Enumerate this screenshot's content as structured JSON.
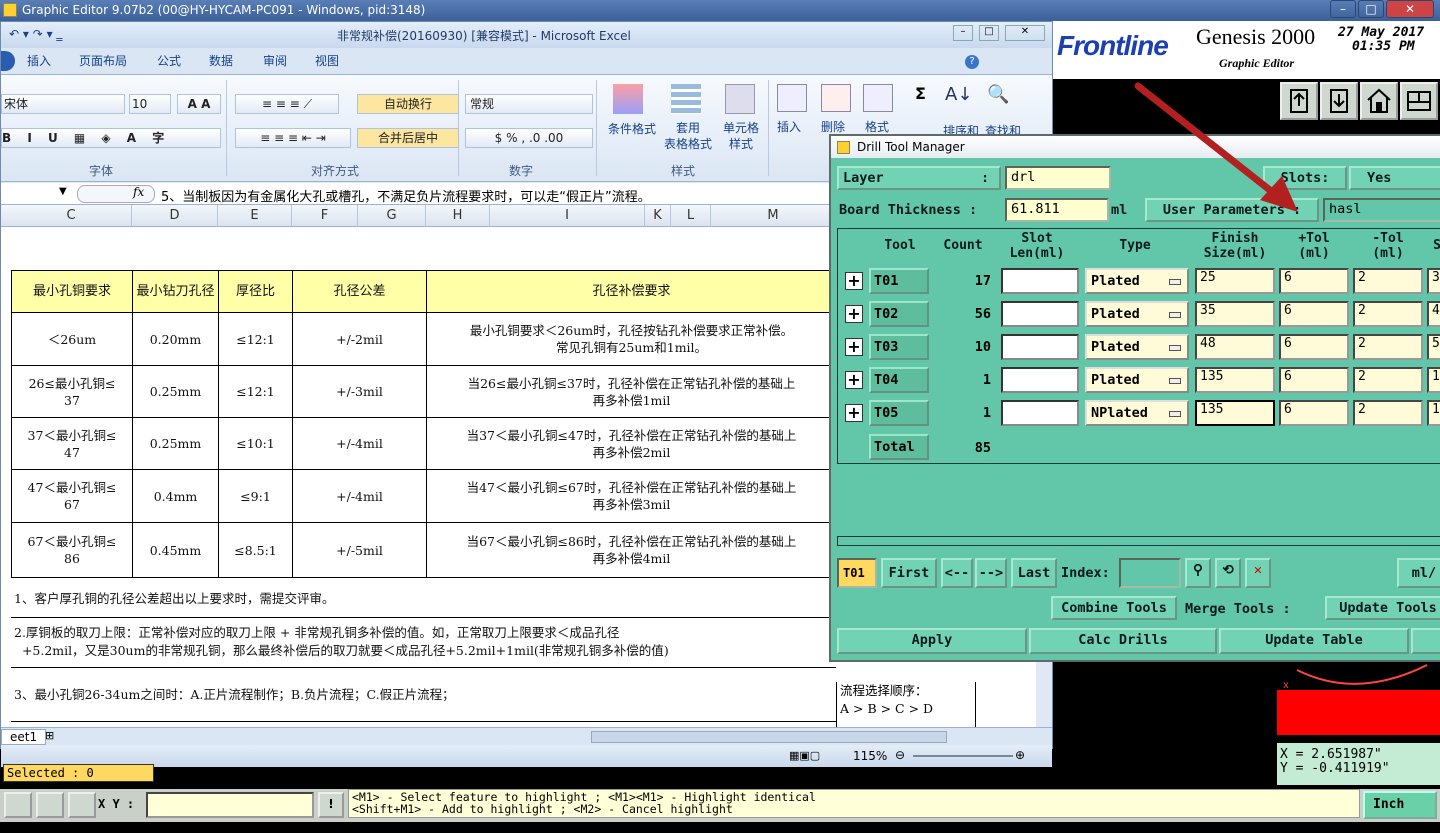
{
  "genesis": {
    "title": "Graphic Editor 9.07b2 (00@HY-HYCAM-PC091 - Windows, pid:3148)",
    "logo": "Frontline",
    "product": "Genesis 2000",
    "subtitle": "Graphic Editor",
    "date": "27 May 2017",
    "time": "01:35 PM",
    "coord_x": "X = 2.651987\"",
    "coord_y": "Y = -0.411919\"",
    "selected": "Selected : 0",
    "xy_label": "X Y :",
    "hint1": "<M1> - Select feature to highlight ; <M1><M1> - Highlight identical",
    "hint2": "<Shift+M1> - Add to highlight ; <M2> - Cancel highlight",
    "units": "Inch",
    "behind_text1": "流程选择顺序：",
    "behind_text2": "A > B > C > D"
  },
  "excel": {
    "title": "非常规补偿(20160930)  [兼容模式] - Microsoft Excel",
    "tabs": [
      "插入",
      "页面布局",
      "公式",
      "数据",
      "审阅",
      "视图"
    ],
    "font_name": "宋体",
    "font_size": "10",
    "number_format": "常规",
    "wrap_text": "自动换行",
    "merge_center": "合并后居中",
    "groups": {
      "font": "字体",
      "align": "对齐方式",
      "number": "数字",
      "style": "样式"
    },
    "style_buttons": [
      "条件格式",
      "套用\n表格格式",
      "单元格\n样式"
    ],
    "cell_buttons": [
      "插入",
      "删除",
      "格式"
    ],
    "edit_buttons": [
      "排序和",
      "查找和"
    ],
    "formula": "5、当制板因为有金属化大孔或槽孔，不满足负片流程要求时，可以走“假正片”流程。",
    "columns": [
      "C",
      "D",
      "E",
      "F",
      "G",
      "H",
      "I",
      "K",
      "L",
      "M"
    ],
    "table_headers": [
      "最小孔铜要求",
      "最小钻刀孔径",
      "厚径比",
      "孔径公差",
      "孔径补偿要求"
    ],
    "rows": [
      [
        "＜26um",
        "0.20mm",
        "≤12:1",
        "+/-2mil",
        "最小孔铜要求＜26um时，孔径按钻孔补偿要求正常补偿。\n常见孔铜有25um和1mil。"
      ],
      [
        "26≤最小孔铜≤\n37",
        "0.25mm",
        "≤12:1",
        "+/-3mil",
        "当26≤最小孔铜≤37时，孔径补偿在正常钻孔补偿的基础上\n再多补偿1mil"
      ],
      [
        "37＜最小孔铜≤\n47",
        "0.25mm",
        "≤10:1",
        "+/-4mil",
        "当37＜最小孔铜≤47时，孔径补偿在正常钻孔补偿的基础上\n再多补偿2mil"
      ],
      [
        "47＜最小孔铜≤\n67",
        "0.4mm",
        "≤9:1",
        "+/-4mil",
        "当47＜最小孔铜≤67时，孔径补偿在正常钻孔补偿的基础上\n再多补偿3mil"
      ],
      [
        "67＜最小孔铜≤\n86",
        "0.45mm",
        "≤8.5:1",
        "+/-5mil",
        "当67＜最小孔铜≤86时，孔径补偿在正常钻孔补偿的基础上\n再多补偿4mil"
      ]
    ],
    "note1": "1、客户厚孔铜的孔径公差超出以上要求时，需提交评审。",
    "note2a": "2.厚铜板的取刀上限：正常补偿对应的取刀上限 + 非常规孔铜多补偿的值。如，正常取刀上限要求＜成品孔径",
    "note2b": "  +5.2mil，又是30um的非常规孔铜，那么最终补偿后的取刀就要＜成品孔径+5.2mil+1mil(非常规孔铜多补偿的值)",
    "note3": "3、最小孔铜26-34um之间时：A.正片流程制作；B.负片流程；C.假正片流程；",
    "sheet_tab": "eet1",
    "zoom": "115%"
  },
  "drill": {
    "title": "Drill Tool Manager",
    "layer_label": "Layer",
    "layer_value": "drl",
    "slots_label": "Slots:",
    "slots_value": "Yes",
    "thickness_label": "Board Thickness :",
    "thickness_value": "61.811",
    "thickness_unit": "ml",
    "user_params_label": "User Parameters :",
    "user_params_value": "hasl",
    "headers": {
      "tool": "Tool",
      "count": "Count",
      "slot": "Slot\nLen(ml)",
      "type": "Type",
      "finish": "Finish\nSize(ml)",
      "ptol": "+Tol\n(ml)",
      "mtol": "-Tol\n(ml)"
    },
    "tools": [
      {
        "name": "T01",
        "count": "17",
        "type": "Plated",
        "finish": "25",
        "ptol": "6",
        "mtol": "2",
        "extra": "3"
      },
      {
        "name": "T02",
        "count": "56",
        "type": "Plated",
        "finish": "35",
        "ptol": "6",
        "mtol": "2",
        "extra": "4"
      },
      {
        "name": "T03",
        "count": "10",
        "type": "Plated",
        "finish": "48",
        "ptol": "6",
        "mtol": "2",
        "extra": "5"
      },
      {
        "name": "T04",
        "count": "1",
        "type": "Plated",
        "finish": "135",
        "ptol": "6",
        "mtol": "2",
        "extra": "1"
      },
      {
        "name": "T05",
        "count": "1",
        "type": "NPlated",
        "finish": "135",
        "ptol": "6",
        "mtol": "2",
        "extra": "1"
      }
    ],
    "total_label": "Total",
    "total_count": "85",
    "current_tool": "T01",
    "nav": {
      "first": "First",
      "prev": "<--",
      "next": "-->",
      "last": "Last",
      "index": "Index:",
      "units": "ml/"
    },
    "combine": "Combine Tools",
    "merge": "Merge Tools :",
    "update_tools": "Update Tools",
    "apply": "Apply",
    "calc": "Calc Drills",
    "update_table": "Update Table"
  }
}
